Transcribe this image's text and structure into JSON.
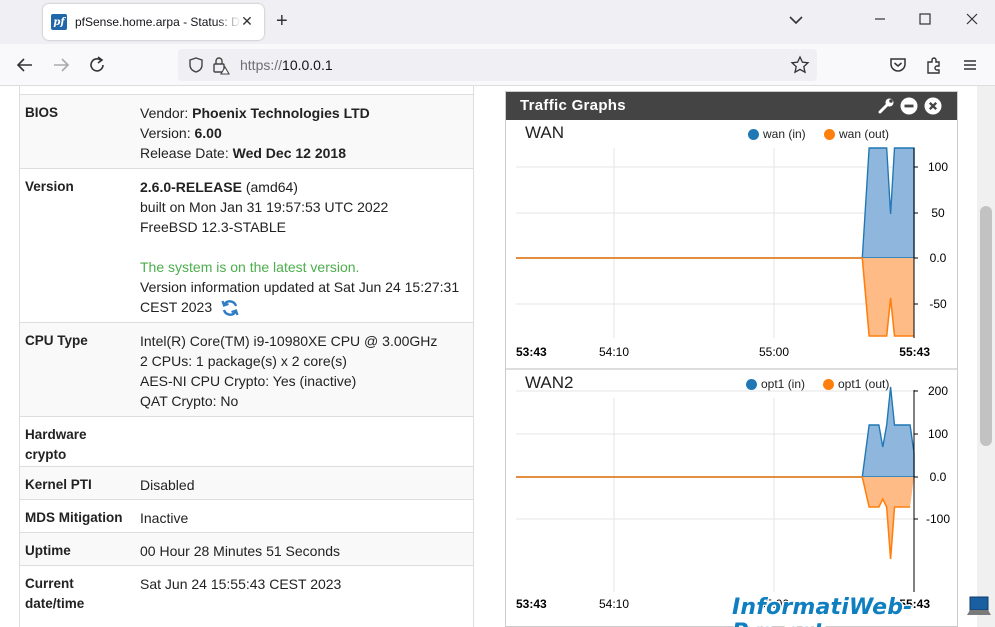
{
  "browser": {
    "tab_title": "pfSense.home.arpa - Status: Dashboard",
    "favicon_text": "pf",
    "url_scheme": "https://",
    "url_host": "10.0.0.1"
  },
  "system_info": {
    "rows": [
      {
        "label": "BIOS",
        "lines": [
          [
            "Vendor: ",
            "Phoenix Technologies LTD"
          ],
          [
            "Version: ",
            "6.00"
          ],
          [
            "Release Date: ",
            "Wed Dec 12 2018"
          ]
        ]
      },
      {
        "label": "Version",
        "version_bold": "2.6.0-RELEASE",
        "version_arch": " (amd64)",
        "built": "built on Mon Jan 31 19:57:53 UTC 2022",
        "freebsd": "FreeBSD 12.3-STABLE",
        "status": "The system is on the latest version.",
        "updated": "Version information updated at Sat Jun 24 15:27:31 CEST 2023"
      },
      {
        "label": "CPU Type",
        "lines": [
          "Intel(R) Core(TM) i9-10980XE CPU @ 3.00GHz",
          "2 CPUs: 1 package(s) x 2 core(s)",
          "AES-NI CPU Crypto: Yes (inactive)",
          "QAT Crypto: No"
        ]
      },
      {
        "label": "Hardware crypto",
        "value": ""
      },
      {
        "label": "Kernel PTI",
        "value": "Disabled"
      },
      {
        "label": "MDS Mitigation",
        "value": "Inactive"
      },
      {
        "label": "Uptime",
        "value": "00 Hour 28 Minutes 51 Seconds"
      },
      {
        "label": "Current date/time",
        "value": "Sat Jun 24 15:55:43 CEST 2023"
      }
    ]
  },
  "widget": {
    "title": "Traffic Graphs",
    "icons": [
      "wrench-icon",
      "minimize-icon",
      "close-icon"
    ]
  },
  "colors": {
    "in": "#1f77b4",
    "out": "#ff7f0e",
    "in_fill": "#8fb6dc",
    "out_fill": "#ffbb86",
    "header": "#444444"
  },
  "chart_data": [
    {
      "type": "area",
      "title": "WAN",
      "series": [
        {
          "name": "wan (in)"
        },
        {
          "name": "wan (out)"
        }
      ],
      "x_ticks": [
        "53:43",
        "54:10",
        "55:00",
        "55:43"
      ],
      "y_ticks": [
        "100",
        "50",
        "0.0",
        "-50"
      ],
      "ylim": [
        -85,
        120
      ],
      "grid": true,
      "legend": "top-right"
    },
    {
      "type": "area",
      "title": "WAN2",
      "series": [
        {
          "name": "opt1 (in)"
        },
        {
          "name": "opt1 (out)"
        }
      ],
      "x_ticks": [
        "53:43",
        "54:10",
        "55:00",
        "55:43"
      ],
      "y_ticks": [
        "200",
        "100",
        "0.0",
        "-100"
      ],
      "ylim": [
        -190,
        250
      ],
      "grid": true,
      "legend": "top-right"
    }
  ],
  "watermark": "InformatiWeb-Pro.net"
}
